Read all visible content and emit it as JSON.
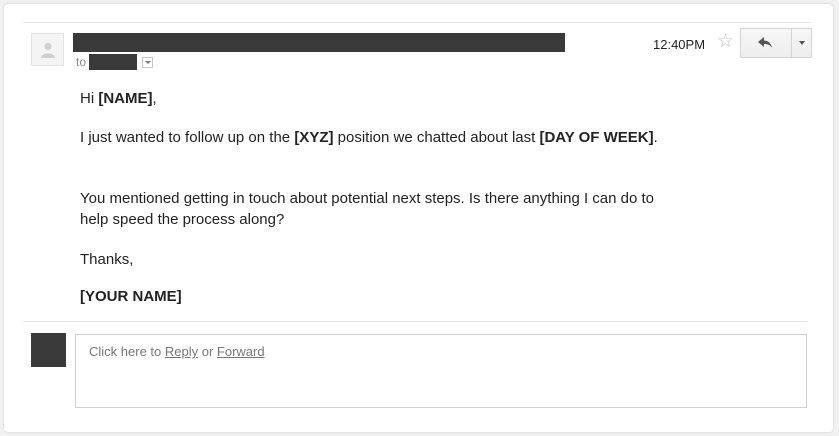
{
  "header": {
    "to_label": "to",
    "timestamp": "12:40PM",
    "star_icon": "star-outline-icon",
    "reply_icon": "reply-arrow-icon",
    "more_icon": "chevron-down-icon"
  },
  "email": {
    "greeting_prefix": "Hi ",
    "greeting_name": "[NAME]",
    "greeting_suffix": ",",
    "p1_a": "I just wanted to follow up on the ",
    "p1_b": "[XYZ]",
    "p1_c": " position we chatted about last ",
    "p1_d": "[DAY OF WEEK]",
    "p1_e": ".",
    "p2": "You mentioned getting in touch about potential next steps. Is there anything I can do to help speed the process along?",
    "closing": "Thanks,",
    "signature": "[YOUR NAME]"
  },
  "reply_bar": {
    "prefix": "Click here to ",
    "reply_link": "Reply",
    "middle": " or ",
    "forward_link": "Forward"
  },
  "colors": {
    "redaction": "#3a3a3a",
    "text": "#222222",
    "muted": "#777777"
  }
}
